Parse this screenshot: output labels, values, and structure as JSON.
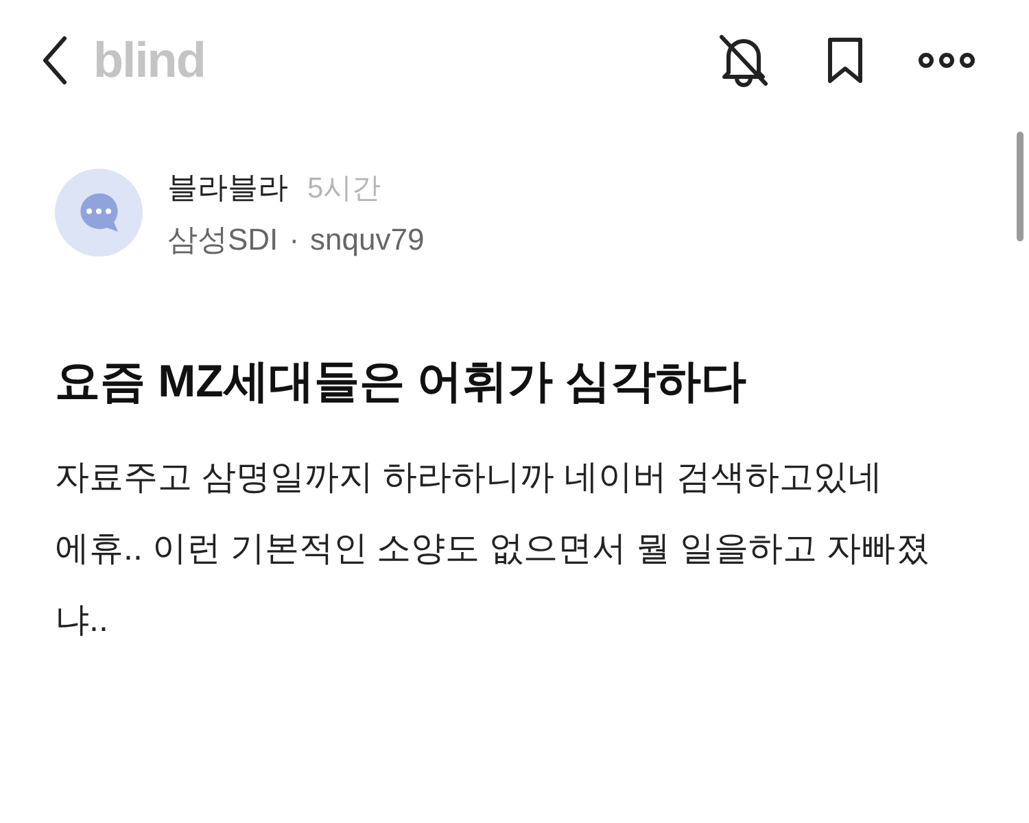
{
  "header": {
    "logo": "blind"
  },
  "post": {
    "author": "블라블라",
    "time": "5시간",
    "company": "삼성SDI",
    "separator": "·",
    "user_id": "snquv79",
    "title": "요즘 MZ세대들은 어휘가 심각하다",
    "body": [
      "자료주고 삼명일까지 하라하니까 네이버 검색하고있네",
      "에휴.. 이런 기본적인 소양도 없으면서 뭘 일을하고 자빠졌냐.."
    ]
  }
}
